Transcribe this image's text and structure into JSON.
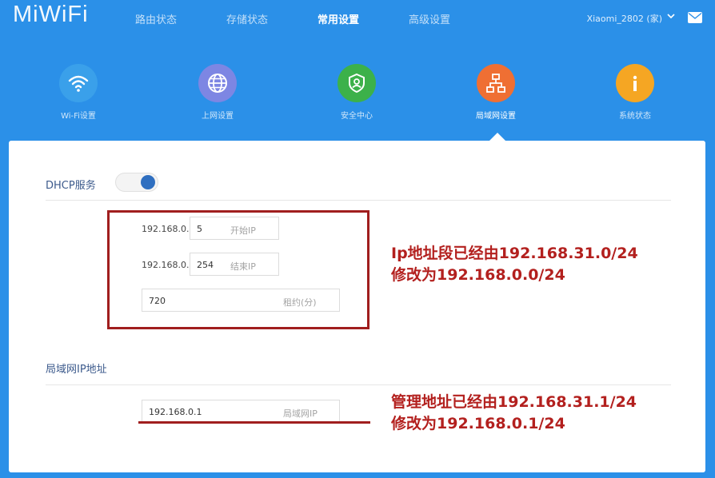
{
  "app": {
    "logo": "MiWiFi",
    "nav": [
      "路由状态",
      "存储状态",
      "常用设置",
      "高级设置"
    ],
    "nav_active": "常用设置",
    "router_name": "Xiaomi_2802 (家)"
  },
  "categories": [
    {
      "label": "Wi-Fi设置",
      "icon": "wifi-icon",
      "color": "#3aa0ea"
    },
    {
      "label": "上网设置",
      "icon": "globe-icon",
      "color": "#7d86e3"
    },
    {
      "label": "安全中心",
      "icon": "shield-user-icon",
      "color": "#3cb14a"
    },
    {
      "label": "局域网设置",
      "icon": "network-icon",
      "color": "#ef6f33"
    },
    {
      "label": "系统状态",
      "icon": "info-icon",
      "color": "#f5a623"
    }
  ],
  "category_active": "局域网设置",
  "dhcp": {
    "title": "DHCP服务",
    "enabled": true,
    "start_prefix": "192.168.0.",
    "start_value": "5",
    "start_placeholder": "开始IP",
    "end_prefix": "192.168.0.",
    "end_value": "254",
    "end_placeholder": "结束IP",
    "lease_value": "720",
    "lease_placeholder": "租约(分)"
  },
  "lan_ip": {
    "title": "局域网IP地址",
    "value": "192.168.0.1",
    "placeholder": "局域网IP"
  },
  "annotations": {
    "dhcp_line1": "Ip地址段已经由192.168.31.0/24",
    "dhcp_line2": "修改为192.168.0.0/24",
    "lan_line1": "管理地址已经由192.168.31.1/24",
    "lan_line2": "修改为192.168.0.1/24"
  },
  "colors": {
    "background": "#2b90e8",
    "annotation": "#b3201e",
    "toggle_on": "#2f6fc0"
  }
}
